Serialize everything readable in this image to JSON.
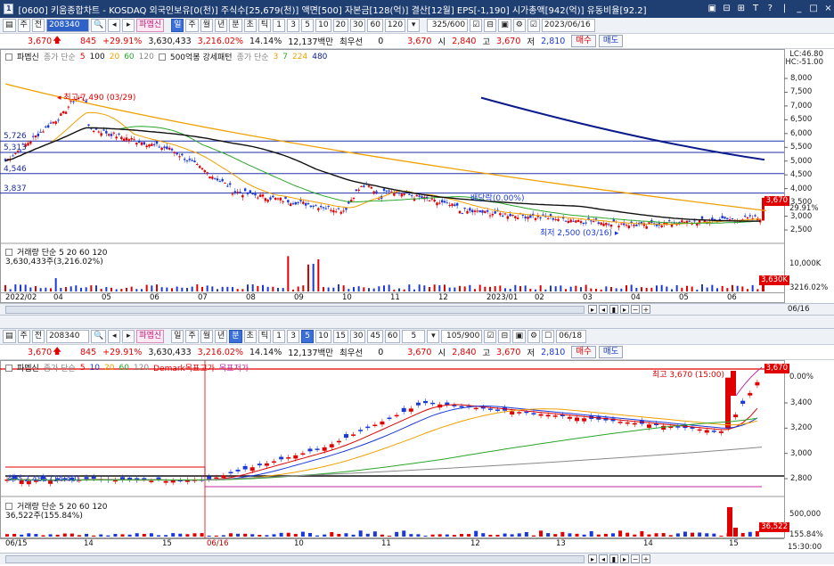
{
  "window": {
    "title": "[0600] 키움종합차트 - KOSDAQ 외국인보유[0(천)] 주식수[25,679(천)] 액면[500] 자본금[128(억)] 결산[12월] EPS[-1,190] 시가총액[942(억)] 유동비율[92.2]",
    "app_icon": "1",
    "controls": [
      "▣",
      "⊟",
      "⊞",
      "T",
      "?",
      "|",
      "_",
      "□",
      "×"
    ]
  },
  "top_toolbar": {
    "market": "주",
    "all": "전",
    "code": "208340",
    "stock_name": "파멥신",
    "buttons": [
      "일",
      "주",
      "월",
      "년",
      "분",
      "초",
      "틱"
    ],
    "active_button": "일",
    "periods": [
      "1",
      "3",
      "5",
      "10",
      "20",
      "30",
      "60",
      "120"
    ],
    "count": "325/600",
    "date": "2023/06/16"
  },
  "top_info": {
    "price": "3,670",
    "change": "845",
    "change_pct": "+29.91%",
    "volume": "3,630,433",
    "volume_ratio": "3,216.02%",
    "turnover": "14.14%",
    "amount": "12,137백만",
    "preferred": "최우선",
    "zero": "0",
    "cur": "3,670",
    "open_label": "시",
    "open": "2,840",
    "high_label": "고",
    "high": "3,670",
    "low_label": "저",
    "low": "2,810",
    "buy": "매수",
    "sell": "매도"
  },
  "top_chart": {
    "legend": [
      "파멥신",
      "종가 단순",
      "5",
      "100",
      "20",
      "60",
      "120",
      "500억봉 강세패턴",
      "종가 단순",
      "3",
      "7",
      "224",
      "480"
    ],
    "lc": "LC:46.80",
    "hc": "HC:-51.00",
    "yticks": [
      "8,000",
      "7,500",
      "7,000",
      "6,500",
      "6,000",
      "5,500",
      "5,000",
      "4,500",
      "4,000",
      "3,500",
      "3,000",
      "2,500"
    ],
    "levels": [
      "5,726",
      "5,313",
      "4,546",
      "3,837"
    ],
    "high_note": "최고 7,490 (03/29)",
    "low_note": "최저 2,500 (03/16)",
    "div_note": "배당락(0.00%)",
    "price_tag": "3,670",
    "pct_tag": "29.91%",
    "volume_legend": "거래량 단순 5 20 60 120",
    "volume_value": "3,630,433주(3,216.02%)",
    "vol_ytick": "10,000K",
    "vol_tag": "3,630K",
    "vol_pct": "3216.02%",
    "dates": [
      "2022/02",
      "04",
      "05",
      "06",
      "07",
      "08",
      "09",
      "10",
      "11",
      "12",
      "2023/01",
      "02",
      "03",
      "04",
      "05",
      "06"
    ],
    "nav_right": "06/16"
  },
  "bottom_toolbar": {
    "market": "주",
    "all": "전",
    "code": "208340",
    "stock_name": "파멥신",
    "buttons": [
      "일",
      "주",
      "월",
      "년",
      "분",
      "초",
      "틱"
    ],
    "active_button": "분",
    "periods": [
      "1",
      "3",
      "5",
      "10",
      "15",
      "30",
      "45",
      "60"
    ],
    "active_period": "5",
    "interval": "5",
    "count": "105/900",
    "date": "06/18"
  },
  "bottom_info": {
    "price": "3,670",
    "change": "845",
    "change_pct": "+29.91%",
    "volume": "3,630,433",
    "volume_ratio": "3,216.02%",
    "turnover": "14.14%",
    "amount": "12,137백만",
    "preferred": "최우선",
    "zero": "0",
    "cur": "3,670",
    "open": "2,840",
    "high": "3,670",
    "low": "2,810",
    "buy": "매수",
    "sell": "매도"
  },
  "bottom_chart": {
    "legend": [
      "파멥신",
      "종가 단순",
      "5",
      "10",
      "20",
      "60",
      "120",
      "Demark목표고가",
      "목표저가"
    ],
    "yticks": [
      "3,400",
      "3,200",
      "3,000",
      "2,800"
    ],
    "price_tag": "3,670",
    "pct_tag": "0.00%",
    "high_note": "최고 3,670 (15:00)",
    "low_note": "최저 2,485 (14:40)",
    "volume_legend": "거래량 단순 5 20 60 120",
    "volume_value": "36,522주(155.84%)",
    "vol_ytick": "500,000",
    "vol_tag": "36,522",
    "vol_pct": "155.84%",
    "dates": [
      "06/15",
      "14",
      "15",
      "06/16",
      "10",
      "11",
      "12",
      "13",
      "14",
      "15"
    ],
    "nav_right": "15:30:00"
  },
  "colors": {
    "up": "#e00000",
    "down": "#1a39d8",
    "ma_black": "#111111",
    "ma_orange": "#f0a000",
    "ma_green": "#2aa52a",
    "ma_navy": "#0a1a8a",
    "title_bar": "#1f3f73"
  }
}
